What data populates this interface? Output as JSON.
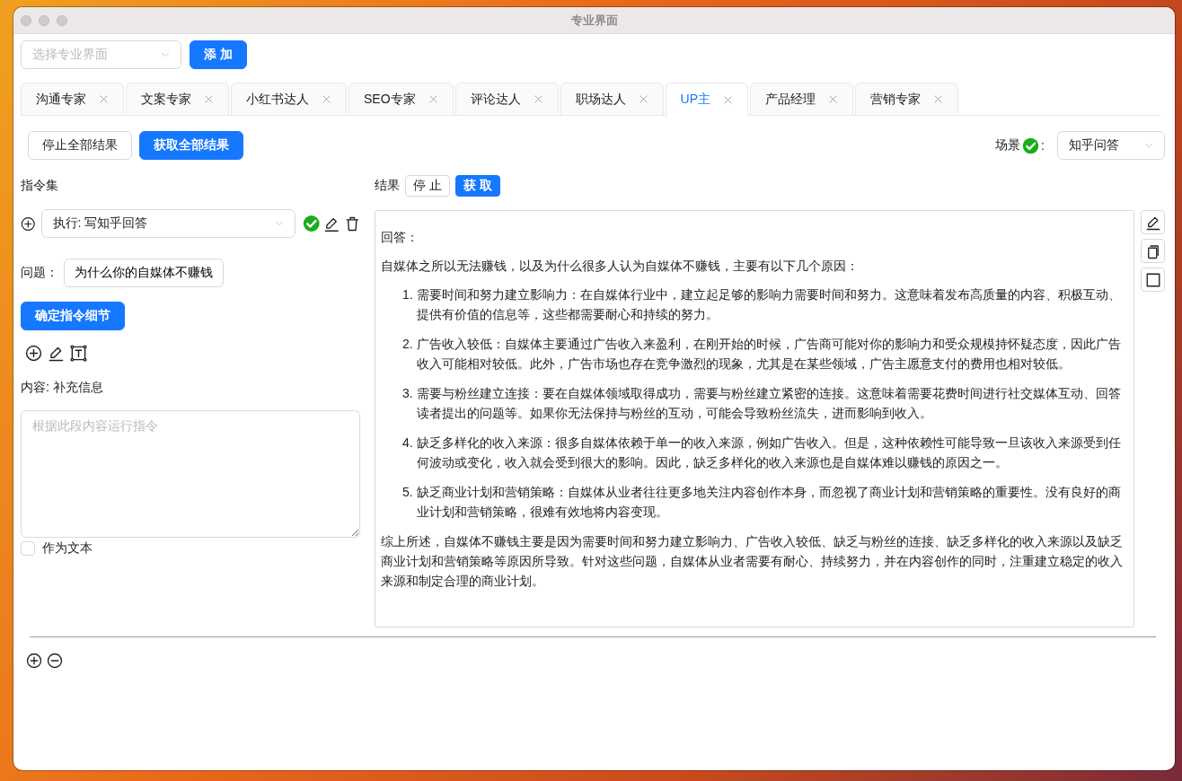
{
  "window": {
    "title": "专业界面"
  },
  "profile_select": {
    "placeholder": "选择专业界面"
  },
  "add_button": "添 加",
  "tabs": [
    {
      "label": "沟通专家",
      "selected": false
    },
    {
      "label": "文案专家",
      "selected": false
    },
    {
      "label": "小红书达人",
      "selected": false
    },
    {
      "label": "SEO专家",
      "selected": false
    },
    {
      "label": "评论达人",
      "selected": false
    },
    {
      "label": "职场达人",
      "selected": false
    },
    {
      "label": "UP主",
      "selected": true
    },
    {
      "label": "产品经理",
      "selected": false
    },
    {
      "label": "营销专家",
      "selected": false
    }
  ],
  "actions": {
    "stop_all": "停止全部结果",
    "fetch_all": "获取全部结果"
  },
  "scene": {
    "label": "场景",
    "colon": ":",
    "value": "知乎问答"
  },
  "instructions": {
    "title": "指令集",
    "command": "执行: 写知乎回答",
    "question_label": "问题：",
    "question_value": "为什么你的自媒体不赚钱",
    "confirm_button": "确定指令细节",
    "content_label": "内容: 补充信息",
    "content_placeholder": "根据此段内容运行指令",
    "as_text": {
      "label": "作为文本",
      "checked": false
    }
  },
  "result": {
    "label": "结果",
    "stop_button": "停 止",
    "fetch_button": "获 取",
    "heading": "回答：",
    "intro": "自媒体之所以无法赚钱，以及为什么很多人认为自媒体不赚钱，主要有以下几个原因：",
    "points": [
      {
        "number": "1.",
        "text": "需要时间和努力建立影响力：在自媒体行业中，建立起足够的影响力需要时间和努力。这意味着发布高质量的内容、积极互动、提供有价值的信息等，这些都需要耐心和持续的努力。"
      },
      {
        "number": "2.",
        "text": "广告收入较低：自媒体主要通过广告收入来盈利，在刚开始的时候，广告商可能对你的影响力和受众规模持怀疑态度，因此广告收入可能相对较低。此外，广告市场也存在竞争激烈的现象，尤其是在某些领域，广告主愿意支付的费用也相对较低。"
      },
      {
        "number": "3.",
        "text": "需要与粉丝建立连接：要在自媒体领域取得成功，需要与粉丝建立紧密的连接。这意味着需要花费时间进行社交媒体互动、回答读者提出的问题等。如果你无法保持与粉丝的互动，可能会导致粉丝流失，进而影响到收入。"
      },
      {
        "number": "4.",
        "text": "缺乏多样化的收入来源：很多自媒体依赖于单一的收入来源，例如广告收入。但是，这种依赖性可能导致一旦该收入来源受到任何波动或变化，收入就会受到很大的影响。因此，缺乏多样化的收入来源也是自媒体难以赚钱的原因之一。"
      },
      {
        "number": "5.",
        "text": "缺乏商业计划和营销策略：自媒体从业者往往更多地关注内容创作本身，而忽视了商业计划和营销策略的重要性。没有良好的商业计划和营销策略，很难有效地将内容变现。"
      }
    ],
    "summary": "综上所述，自媒体不赚钱主要是因为需要时间和努力建立影响力、广告收入较低、缺乏与粉丝的连接、缺乏多样化的收入来源以及缺乏商业计划和营销策略等原因所导致。针对这些问题，自媒体从业者需要有耐心、持续努力，并在内容创作的同时，注重建立稳定的收入来源和制定合理的商业计划。"
  }
}
